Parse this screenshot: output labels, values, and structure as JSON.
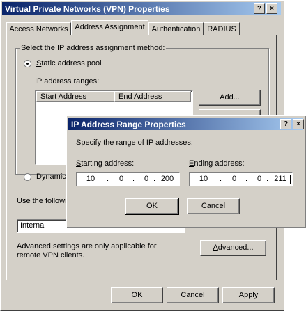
{
  "main_dialog": {
    "title": "Virtual Private Networks (VPN) Properties",
    "help_btn": "?",
    "close_btn": "×",
    "tabs": [
      {
        "label": "Access Networks",
        "active": false
      },
      {
        "label": "Address Assignment",
        "active": true
      },
      {
        "label": "Authentication",
        "active": false
      },
      {
        "label": "RADIUS",
        "active": false
      }
    ],
    "group_label": "Select the IP address assignment method:",
    "static_radio": "Static address pool",
    "ip_ranges_label": "IP address ranges:",
    "columns": [
      "Start Address",
      "End Address"
    ],
    "add_btn": "Add...",
    "dhcp_radio": "Dynamic H",
    "use_following": "Use the followin",
    "network_value": "Internal",
    "advanced_note_1": "Advanced settings are only applicable for",
    "advanced_note_2": "remote VPN clients.",
    "advanced_btn": "Advanced...",
    "ok_btn": "OK",
    "cancel_btn": "Cancel",
    "apply_btn": "Apply"
  },
  "range_dialog": {
    "title": "IP Address Range Properties",
    "help_btn": "?",
    "close_btn": "×",
    "instruction": "Specify the range of IP addresses:",
    "starting_label": "Starting address:",
    "ending_label": "Ending address:",
    "starting": [
      "10",
      "0",
      "0",
      "200"
    ],
    "ending": [
      "10",
      "0",
      "0",
      "211"
    ],
    "ok_btn": "OK",
    "cancel_btn": "Cancel"
  }
}
